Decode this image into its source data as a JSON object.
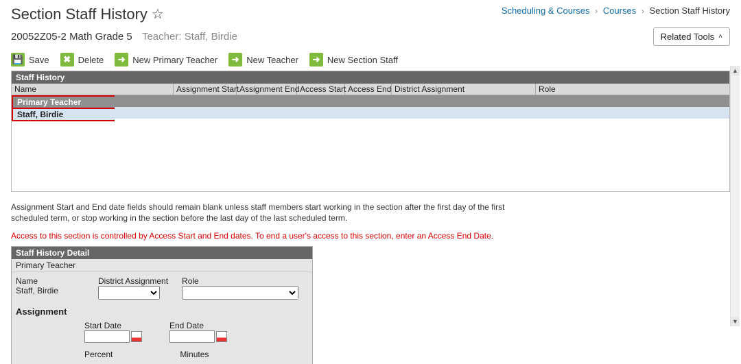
{
  "header": {
    "title": "Section Staff History",
    "breadcrumb": [
      "Scheduling & Courses",
      "Courses",
      "Section Staff History"
    ],
    "course": "20052Z05-2 Math Grade 5",
    "teacher_label": "Teacher: Staff, Birdie",
    "related_tools": "Related Tools"
  },
  "toolbar": {
    "save": "Save",
    "delete": "Delete",
    "new_primary": "New Primary Teacher",
    "new_teacher": "New Teacher",
    "new_staff": "New Section Staff"
  },
  "grid": {
    "title": "Staff History",
    "cols": {
      "name": "Name",
      "assign_start": "Assignment Start",
      "assign_end": "Assignment End",
      "access_start": "Access Start",
      "access_end": "Access End",
      "district": "District Assignment",
      "role": "Role"
    },
    "group_label": "Primary Teacher",
    "row_name": "Staff, Birdie"
  },
  "help": {
    "line1": "Assignment Start and End date fields should remain blank unless staff members start working in the section after the first day of the first scheduled term, or stop working in the section before the last day of the last scheduled term.",
    "line2": "Access to this section is controlled by Access Start and End dates. To end a user's access to this section, enter an Access End Date."
  },
  "detail": {
    "title": "Staff History Detail",
    "subtitle": "Primary Teacher",
    "name_label": "Name",
    "name_value": "Staff, Birdie",
    "district_label": "District Assignment",
    "role_label": "Role",
    "assignment_header": "Assignment",
    "start_date_label": "Start Date",
    "end_date_label": "End Date",
    "percent_label": "Percent",
    "minutes_label": "Minutes"
  }
}
